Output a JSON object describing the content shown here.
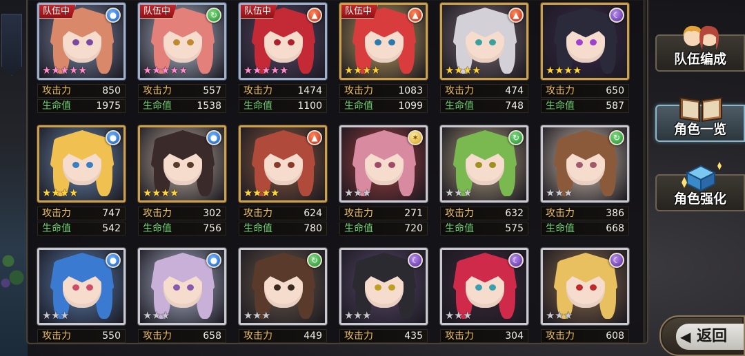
{
  "team_badge_label": "队伍中",
  "stat_labels": {
    "attack": "攻击力",
    "hp": "生命值"
  },
  "characters": [
    {
      "element": "water",
      "element_icon": "water-drop-icon",
      "in_team": true,
      "stars": 5,
      "star_color": "pink",
      "frame": "blueframe",
      "hair": "#d9896a",
      "eyes": "#7a4aa0",
      "bg": "#7d8aa8",
      "attack": "850",
      "hp": "1975"
    },
    {
      "element": "wind",
      "element_icon": "wind-swirl-icon",
      "in_team": true,
      "stars": 5,
      "star_color": "pink",
      "frame": "blueframe",
      "hair": "#e4807a",
      "eyes": "#c08a30",
      "bg": "#b6c0d4",
      "attack": "557",
      "hp": "1538"
    },
    {
      "element": "fire",
      "element_icon": "flame-icon",
      "in_team": true,
      "stars": 5,
      "star_color": "pink",
      "frame": "blueframe",
      "hair": "#c42a36",
      "eyes": "#b0202a",
      "bg": "#5a4a6a",
      "attack": "1474",
      "hp": "1100"
    },
    {
      "element": "fire",
      "element_icon": "flame-icon",
      "in_team": true,
      "stars": 4,
      "star_color": "gold",
      "frame": "gold",
      "hair": "#d83c3c",
      "eyes": "#2a7ab0",
      "bg": "#c0a060",
      "attack": "1083",
      "hp": "1099"
    },
    {
      "element": "fire",
      "element_icon": "flame-icon",
      "in_team": false,
      "stars": 4,
      "star_color": "gold",
      "frame": "gold",
      "hair": "#d4d0d8",
      "eyes": "#3aa0a0",
      "bg": "#7a6a70",
      "attack": "474",
      "hp": "748"
    },
    {
      "element": "dark",
      "element_icon": "crescent-moon-icon",
      "in_team": false,
      "stars": 4,
      "star_color": "gold",
      "frame": "gold",
      "hair": "#2a2a3a",
      "eyes": "#a040d0",
      "bg": "#3a2a4a",
      "attack": "650",
      "hp": "587"
    },
    {
      "element": "water",
      "element_icon": "water-drop-icon",
      "in_team": false,
      "stars": 4,
      "star_color": "gold",
      "frame": "gold",
      "hair": "#f0c050",
      "eyes": "#3a80c0",
      "bg": "#6a8ab0",
      "attack": "747",
      "hp": "542"
    },
    {
      "element": "water",
      "element_icon": "water-drop-icon",
      "in_team": false,
      "stars": 4,
      "star_color": "gold",
      "frame": "gold",
      "hair": "#3a2a2a",
      "eyes": "#5a3a2a",
      "bg": "#c0b0a0",
      "attack": "302",
      "hp": "756"
    },
    {
      "element": "fire",
      "element_icon": "flame-icon",
      "in_team": false,
      "stars": 4,
      "star_color": "gold",
      "frame": "gold",
      "hair": "#b04a3a",
      "eyes": "#8a3a2a",
      "bg": "#8a5a40",
      "attack": "624",
      "hp": "780"
    },
    {
      "element": "light",
      "element_icon": "sun-icon",
      "in_team": false,
      "stars": 3,
      "star_color": "gray",
      "frame": "silver",
      "hair": "#d88aa0",
      "eyes": "#a04a6a",
      "bg": "#a04040",
      "attack": "271",
      "hp": "720"
    },
    {
      "element": "wind",
      "element_icon": "wind-swirl-icon",
      "in_team": false,
      "stars": 3,
      "star_color": "gray",
      "frame": "silver",
      "hair": "#7ab850",
      "eyes": "#a09020",
      "bg": "#b0a080",
      "attack": "632",
      "hp": "575"
    },
    {
      "element": "wind",
      "element_icon": "wind-swirl-icon",
      "in_team": false,
      "stars": 3,
      "star_color": "gray",
      "frame": "silver",
      "hair": "#8a5a3a",
      "eyes": "#a05a6a",
      "bg": "#d0c0b0",
      "attack": "386",
      "hp": "668"
    },
    {
      "element": "water",
      "element_icon": "water-drop-icon",
      "in_team": false,
      "stars": 3,
      "star_color": "gray",
      "frame": "silver",
      "hair": "#3a7ad0",
      "eyes": "#d04a6a",
      "bg": "#5a80b0",
      "attack": "550",
      "hp": ""
    },
    {
      "element": "water",
      "element_icon": "water-drop-icon",
      "in_team": false,
      "stars": 3,
      "star_color": "gray",
      "frame": "silver",
      "hair": "#c8b0d8",
      "eyes": "#8a5ab0",
      "bg": "#b0b8d0",
      "attack": "658",
      "hp": ""
    },
    {
      "element": "wind",
      "element_icon": "wind-swirl-icon",
      "in_team": false,
      "stars": 3,
      "star_color": "gray",
      "frame": "silver",
      "hair": "#5a3a2a",
      "eyes": "#3a2a20",
      "bg": "#6a5a4a",
      "attack": "449",
      "hp": ""
    },
    {
      "element": "dark",
      "element_icon": "crescent-moon-icon",
      "in_team": false,
      "stars": 3,
      "star_color": "gray",
      "frame": "silver",
      "hair": "#2a2a30",
      "eyes": "#c0a020",
      "bg": "#5a4a6a",
      "attack": "435",
      "hp": ""
    },
    {
      "element": "dark",
      "element_icon": "crescent-moon-icon",
      "in_team": false,
      "stars": 3,
      "star_color": "gray",
      "frame": "silver",
      "hair": "#d02a4a",
      "eyes": "#3aa0b0",
      "bg": "#3a2a3a",
      "attack": "304",
      "hp": ""
    },
    {
      "element": "dark",
      "element_icon": "crescent-moon-icon",
      "in_team": false,
      "stars": 3,
      "star_color": "gray",
      "frame": "silver",
      "hair": "#e8c060",
      "eyes": "#c02a2a",
      "bg": "#8a6a4a",
      "attack": "608",
      "hp": ""
    }
  ],
  "side_menu": {
    "party": "队伍编成",
    "characters": "角色一览",
    "enhance": "角色强化"
  },
  "back_button": {
    "arrow": "◀",
    "label": "返回"
  }
}
